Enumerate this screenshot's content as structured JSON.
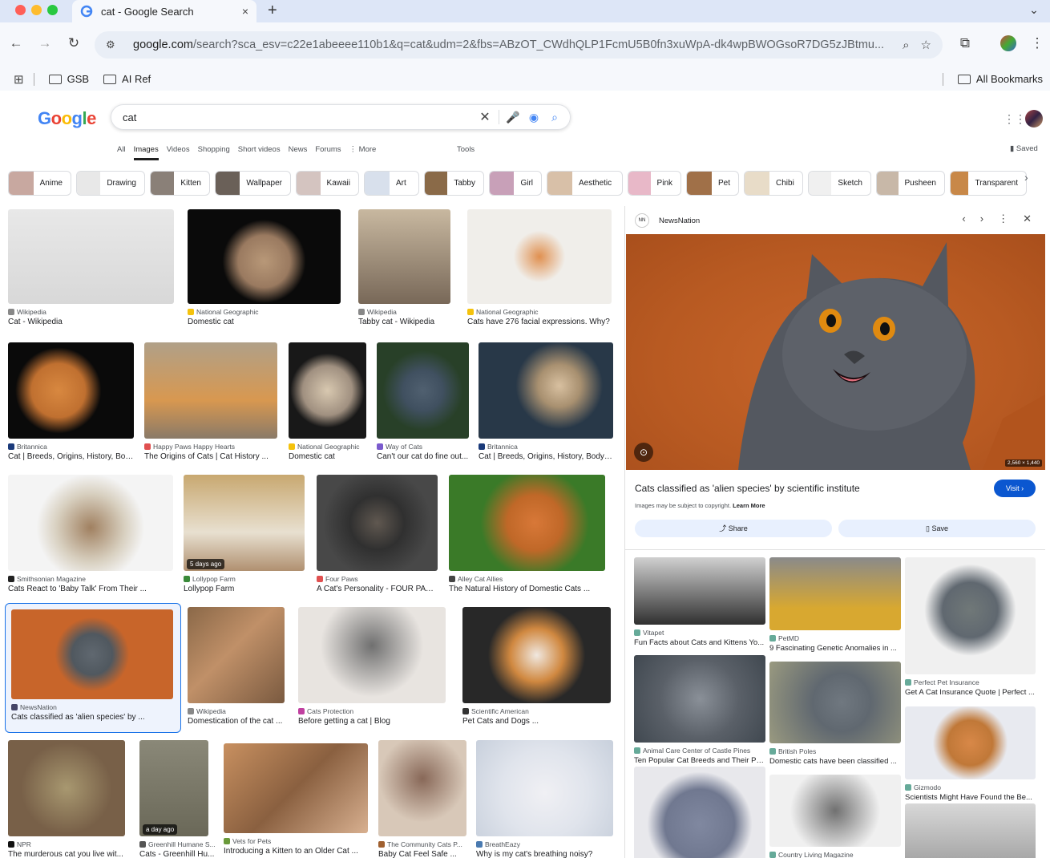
{
  "browser": {
    "tab_title": "cat - Google Search",
    "tab_close": "×",
    "new_tab": "+",
    "url_host": "google.com",
    "url_rest": "/search?sca_esv=c22e1abeeee110b1&q=cat&udm=2&fbs=ABzOT_CWdhQLP1FcmU5B0fn3xuWpA-dk4wpBWOGsoR7DG5zJBtmu...",
    "bookmarks": [
      "GSB",
      "AI Ref"
    ],
    "all_bookmarks": "All Bookmarks"
  },
  "google": {
    "logo": "Google",
    "query": "cat",
    "nav_tabs": [
      "All",
      "Images",
      "Videos",
      "Shopping",
      "Short videos",
      "News",
      "Forums",
      "⋮ More"
    ],
    "tools": "Tools",
    "saved": "Saved",
    "chips": [
      "Anime",
      "Drawing",
      "Kitten",
      "Wallpaper",
      "Kawaii",
      "Art",
      "Tabby",
      "Girl",
      "Aesthetic",
      "Pink",
      "Pet",
      "Chibi",
      "Sketch",
      "Pusheen",
      "Transparent"
    ]
  },
  "results": [
    {
      "source": "Wikipedia",
      "title": "Cat - Wikipedia"
    },
    {
      "source": "National Geographic",
      "title": "Domestic cat"
    },
    {
      "source": "Wikipedia",
      "title": "Tabby cat - Wikipedia"
    },
    {
      "source": "National Geographic",
      "title": "Cats have 276 facial expressions. Why?"
    },
    {
      "source": "Britannica",
      "title": "Cat | Breeds, Origins, History, Bod..."
    },
    {
      "source": "Happy Paws Happy Hearts",
      "title": "The Origins of Cats | Cat History ..."
    },
    {
      "source": "National Geographic",
      "title": "Domestic cat"
    },
    {
      "source": "Way of Cats",
      "title": "Can't our cat do fine out..."
    },
    {
      "source": "Britannica",
      "title": "Cat | Breeds, Origins, History, Body ..."
    },
    {
      "source": "Smithsonian Magazine",
      "title": "Cats React to 'Baby Talk' From Their ..."
    },
    {
      "source": "Lollypop Farm",
      "title": "Lollypop Farm",
      "badge": "5 days ago"
    },
    {
      "source": "Four Paws",
      "title": "A Cat's Personality - FOUR PAWS..."
    },
    {
      "source": "Alley Cat Allies",
      "title": "The Natural History of Domestic Cats ..."
    },
    {
      "source": "NewsNation",
      "title": "Cats classified as 'alien species' by ..."
    },
    {
      "source": "Wikipedia",
      "title": "Domestication of the cat ..."
    },
    {
      "source": "Cats Protection",
      "title": "Before getting a cat | Blog"
    },
    {
      "source": "Scientific American",
      "title": "Pet Cats and Dogs ..."
    },
    {
      "source": "NPR",
      "title": "The murderous cat you live wit..."
    },
    {
      "source": "Greenhill Humane S...",
      "title": "Cats - Greenhill Hu...",
      "badge": "a day ago"
    },
    {
      "source": "Vets for Pets",
      "title": "Introducing a Kitten to an Older Cat ..."
    },
    {
      "source": "The Community Cats P...",
      "title": "Baby Cat Feel Safe ..."
    },
    {
      "source": "BreathEazy",
      "title": "Why is my cat's breathing noisy?"
    }
  ],
  "panel": {
    "logo_text": "NN",
    "source": "NewsNation",
    "dimensions": "2,560 × 1,440",
    "title": "Cats classified as 'alien species' by scientific institute",
    "visit": "Visit ›",
    "copyright": "Images may be subject to copyright.",
    "learn_more": "Learn More",
    "share": "Share",
    "save": "Save",
    "related": [
      {
        "source": "Vitapet",
        "title": "Fun Facts about Cats and Kittens Yo..."
      },
      {
        "source": "PetMD",
        "title": "9 Fascinating Genetic Anomalies in ..."
      },
      {
        "source": "Perfect Pet Insurance",
        "title": "Get A Cat Insurance Quote | Perfect ..."
      },
      {
        "source": "Animal Care Center of Castle Pines",
        "title": "Ten Popular Cat Breeds and Their Pe..."
      },
      {
        "source": "British Poles",
        "title": "Domestic cats have been classified ..."
      },
      {
        "source": "Gizmodo",
        "title": "Scientists Might Have Found the Be..."
      },
      {
        "source": "Country Living Magazine",
        "title": ""
      }
    ]
  }
}
